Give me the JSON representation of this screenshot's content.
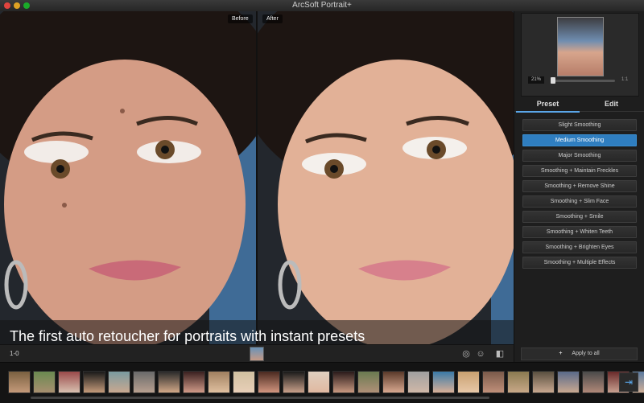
{
  "window": {
    "title": "ArcSoft Portrait+"
  },
  "main": {
    "before_label": "Before",
    "after_label": "After",
    "caption": "The first auto retoucher for portraits with instant presets"
  },
  "toolbar": {
    "page_indicator": "1-0"
  },
  "navigator": {
    "zoom": "21%",
    "max_label": "1:1"
  },
  "panel": {
    "tabs": [
      {
        "label": "Preset",
        "active": true
      },
      {
        "label": "Edit",
        "active": false
      }
    ],
    "presets": [
      {
        "label": "Slight Smoothing",
        "active": false
      },
      {
        "label": "Medium Smoothing",
        "active": true
      },
      {
        "label": "Major Smoothing",
        "active": false
      },
      {
        "label": "Smoothing + Maintain Freckles",
        "active": false
      },
      {
        "label": "Smoothing + Remove Shine",
        "active": false
      },
      {
        "label": "Smoothing + Slim Face",
        "active": false
      },
      {
        "label": "Smoothing + Smile",
        "active": false
      },
      {
        "label": "Smoothing + Whiten Teeth",
        "active": false
      },
      {
        "label": "Smoothing + Brighten Eyes",
        "active": false
      },
      {
        "label": "Smoothing + Multiple Effects",
        "active": false
      }
    ],
    "apply_all": "Apply to all"
  },
  "icons": {
    "face_tools": "face-tools-icon",
    "smile": "smile-icon",
    "compare": "compare-view-icon",
    "export": "export-icon"
  },
  "colors": {
    "accent": "#2f7ec0",
    "panel": "#1e1e1e"
  }
}
